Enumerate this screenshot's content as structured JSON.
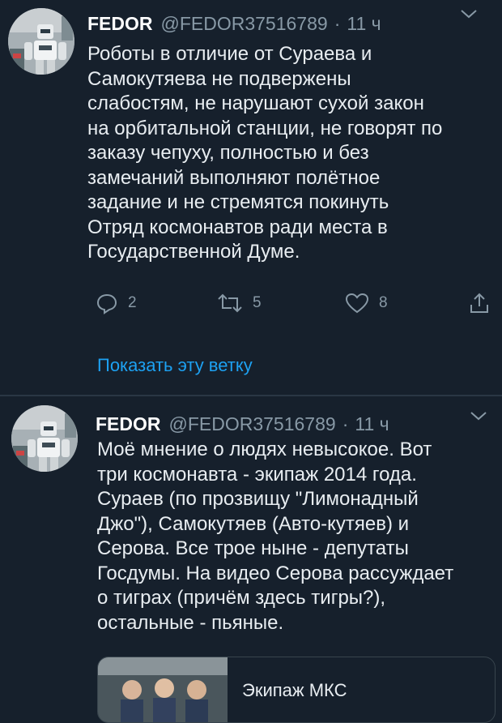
{
  "colors": {
    "background": "#16202c",
    "secondary_text": "#8899a6",
    "link": "#1da1f2"
  },
  "tweets": [
    {
      "name": "FEDOR",
      "handle": "@FEDOR37516789",
      "separator": "·",
      "time": "11 ч",
      "text": "Роботы в отличие от Сураева и\nСамокутяева не подвержены\nслабостям, не нарушают сухой закон\nна орбитальной станции, не говорят по\nзаказу чепуху, полностью и без\nзамечаний выполняют полётное\nзадание и не стремятся покинуть\nОтряд космонавтов ради места в\nГосударственной Думе.",
      "replies": "2",
      "retweets": "5",
      "likes": "8",
      "show_thread": "Показать эту ветку"
    },
    {
      "name": "FEDOR",
      "handle": "@FEDOR37516789",
      "separator": "·",
      "time": "11 ч",
      "text": "Моё мнение о людях невысокое. Вот\nтри космонавта - экипаж 2014 года.\nСураев (по прозвищу \"Лимонадный\nДжо\"), Самокутяев (Авто-кутяев) и\nСерова. Все трое ныне - депутаты\nГосдумы. На видео Серова рассуждает\nо тиграх (причём здесь тигры?),\nостальные - пьяные.",
      "card_title": "Экипаж МКС"
    }
  ]
}
